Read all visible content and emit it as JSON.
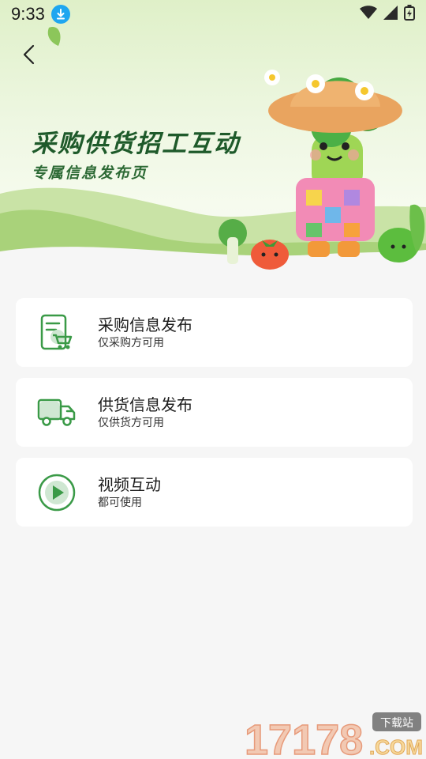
{
  "status_bar": {
    "time": "9:33"
  },
  "header": {
    "title": "采购供货招工互动",
    "subtitle": "专属信息发布页"
  },
  "cards": [
    {
      "title": "采购信息发布",
      "subtitle": "仅采购方可用",
      "icon": "purchase-list-cart-icon"
    },
    {
      "title": "供货信息发布",
      "subtitle": "仅供货方可用",
      "icon": "delivery-truck-icon"
    },
    {
      "title": "视频互动",
      "subtitle": "都可使用",
      "icon": "play-circle-icon"
    }
  ],
  "watermark": {
    "number": "17178",
    "domain": ".COM",
    "tag": "下载站"
  },
  "colors": {
    "accent": "#3a9a47",
    "title": "#1e5a2a",
    "card_bg": "#ffffff",
    "page_bg": "#f6f6f6"
  }
}
